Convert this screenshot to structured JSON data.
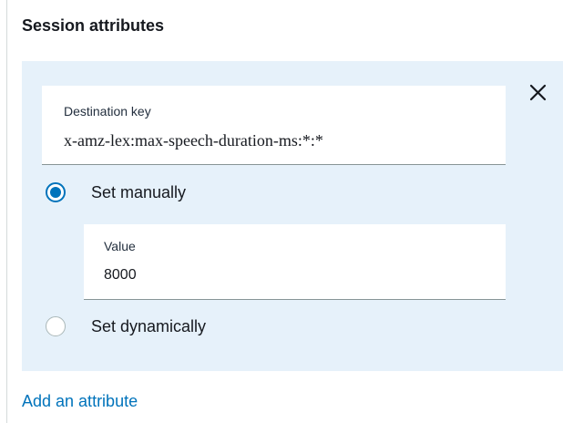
{
  "section": {
    "title": "Session attributes"
  },
  "attribute": {
    "destination_key": {
      "label": "Destination key",
      "value": "x-amz-lex:max-speech-duration-ms:*:*"
    },
    "options": {
      "manual": {
        "label": "Set manually",
        "selected": true
      },
      "dynamic": {
        "label": "Set dynamically",
        "selected": false
      }
    },
    "value_field": {
      "label": "Value",
      "value": "8000"
    },
    "close_icon": "close-icon"
  },
  "footer": {
    "add_link_label": "Add an attribute"
  },
  "colors": {
    "panel_background": "#e6f1fa",
    "accent": "#0073bb",
    "text": "#16191f"
  }
}
